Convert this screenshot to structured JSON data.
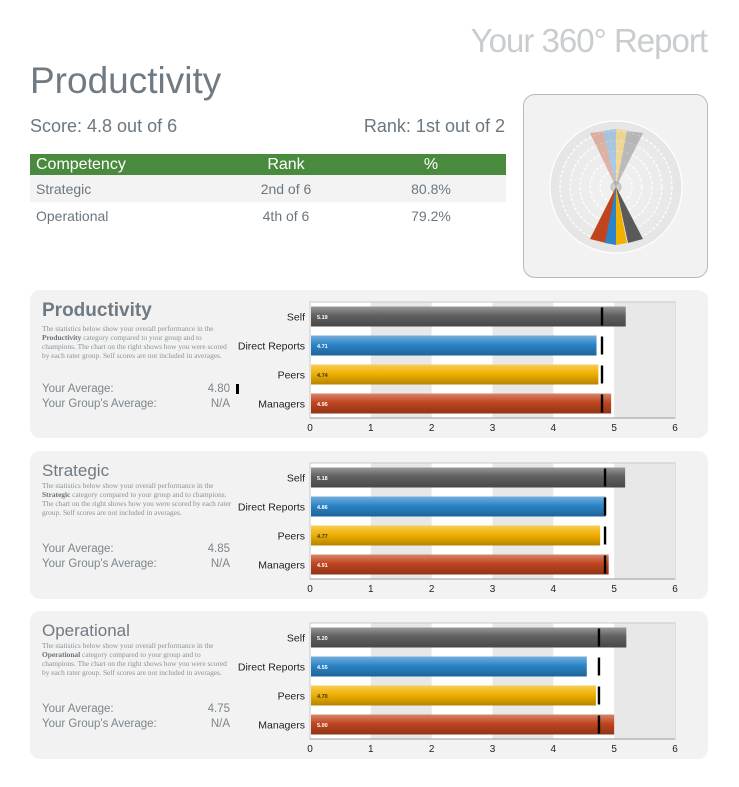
{
  "header": {
    "report_title": "Your 360° Report",
    "title": "Productivity",
    "score": "Score: 4.8 out of 6",
    "rank": "Rank: 1st out of 2"
  },
  "competency_table": {
    "columns": [
      "Competency",
      "Rank",
      "%"
    ],
    "rows": [
      {
        "competency": "Strategic",
        "rank": "2nd of 6",
        "pct": "80.8%"
      },
      {
        "competency": "Operational",
        "rank": "4th of 6",
        "pct": "79.2%"
      }
    ]
  },
  "radar": {
    "series": [
      {
        "name": "Self",
        "color": "#5a5a5a"
      },
      {
        "name": "Direct Reports",
        "color": "#2b84c8"
      },
      {
        "name": "Peers",
        "color": "#f2b000"
      },
      {
        "name": "Managers",
        "color": "#c0451f"
      }
    ]
  },
  "panels": [
    {
      "title": "Productivity",
      "desc_pre": "The statistics below show your overall performance in the ",
      "desc_bold": "Productivity",
      "desc_post": " category compared to your group and to champions. The chart on the right shows how you were scored by each rater group. Self scores are not included in averages.",
      "your_average_label": "Your Average:",
      "your_average_value": "4.80",
      "group_average_label": "Your Group's Average:",
      "group_average_value": "N/A"
    },
    {
      "title": "Strategic",
      "desc_pre": "The statistics below show your overall performance in the ",
      "desc_bold": "Strategic",
      "desc_post": " category compared to your group and to champions. The chart on the right shows how you were scored by each rater group. Self scores are not included in averages.",
      "your_average_label": "Your Average:",
      "your_average_value": "4.85",
      "group_average_label": "Your Group's Average:",
      "group_average_value": "N/A"
    },
    {
      "title": "Operational",
      "desc_pre": "The statistics below show your overall performance in the ",
      "desc_bold": "Operational",
      "desc_post": " category compared to your group and to champions. The chart on the right shows how you were scored by each rater group. Self scores are not included in averages.",
      "your_average_label": "Your Average:",
      "your_average_value": "4.75",
      "group_average_label": "Your Group's Average:",
      "group_average_value": "N/A"
    }
  ],
  "chart_data": [
    {
      "type": "bar",
      "orientation": "horizontal",
      "categories": [
        "Self",
        "Direct Reports",
        "Peers",
        "Managers"
      ],
      "values": [
        5.19,
        4.71,
        4.74,
        4.95
      ],
      "value_labels": [
        "5.19",
        "4.71",
        "4.74",
        "4.95"
      ],
      "markers": [
        4.8,
        4.8,
        4.8,
        4.8
      ],
      "colors": [
        "#606060",
        "#2b84c8",
        "#f2b000",
        "#c0451f"
      ],
      "xlim": [
        0,
        6
      ],
      "ticks": [
        "0",
        "1",
        "2",
        "3",
        "4",
        "5",
        "6"
      ]
    },
    {
      "type": "bar",
      "orientation": "horizontal",
      "categories": [
        "Self",
        "Direct Reports",
        "Peers",
        "Managers"
      ],
      "values": [
        5.18,
        4.86,
        4.77,
        4.91
      ],
      "value_labels": [
        "5.18",
        "4.86",
        "4.77",
        "4.91"
      ],
      "markers": [
        4.85,
        4.85,
        4.85,
        4.85
      ],
      "colors": [
        "#606060",
        "#2b84c8",
        "#f2b000",
        "#c0451f"
      ],
      "xlim": [
        0,
        6
      ],
      "ticks": [
        "0",
        "1",
        "2",
        "3",
        "4",
        "5",
        "6"
      ]
    },
    {
      "type": "bar",
      "orientation": "horizontal",
      "categories": [
        "Self",
        "Direct Reports",
        "Peers",
        "Managers"
      ],
      "values": [
        5.2,
        4.55,
        4.7,
        5.0
      ],
      "value_labels": [
        "5.20",
        "4.55",
        "4.70",
        "5.00"
      ],
      "markers": [
        4.75,
        4.75,
        4.75,
        4.75
      ],
      "colors": [
        "#606060",
        "#2b84c8",
        "#f2b000",
        "#c0451f"
      ],
      "xlim": [
        0,
        6
      ],
      "ticks": [
        "0",
        "1",
        "2",
        "3",
        "4",
        "5",
        "6"
      ]
    }
  ]
}
